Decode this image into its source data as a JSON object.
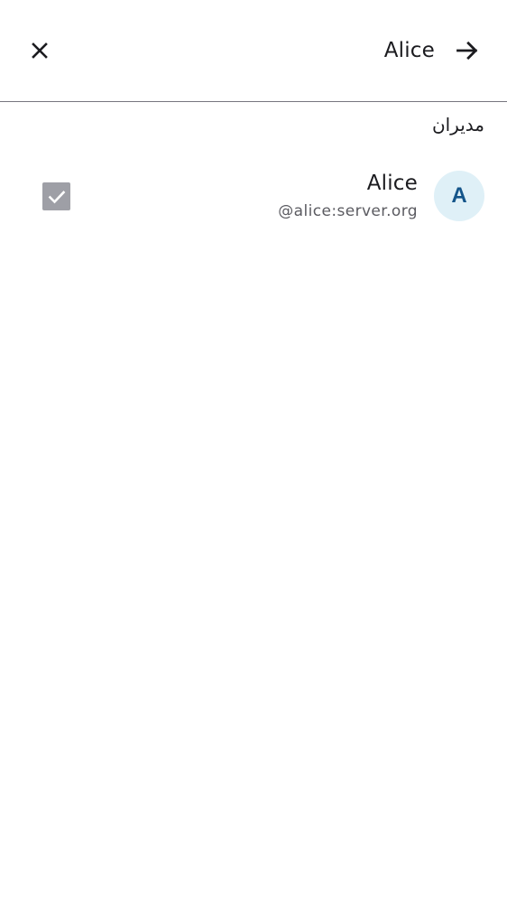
{
  "header": {
    "title": "Alice",
    "close_icon": "close-icon",
    "next_icon": "arrow-forward-icon"
  },
  "section": {
    "title": "مدیران"
  },
  "members": [
    {
      "avatar_letter": "A",
      "name": "Alice",
      "user_id": "@alice:server.org",
      "checked": true,
      "checkbox_disabled": true
    }
  ],
  "colors": {
    "avatar_bg": "#dff0f7",
    "avatar_text": "#14558a",
    "checkbox_disabled": "#9e9fa6",
    "divider": "#77767f"
  }
}
